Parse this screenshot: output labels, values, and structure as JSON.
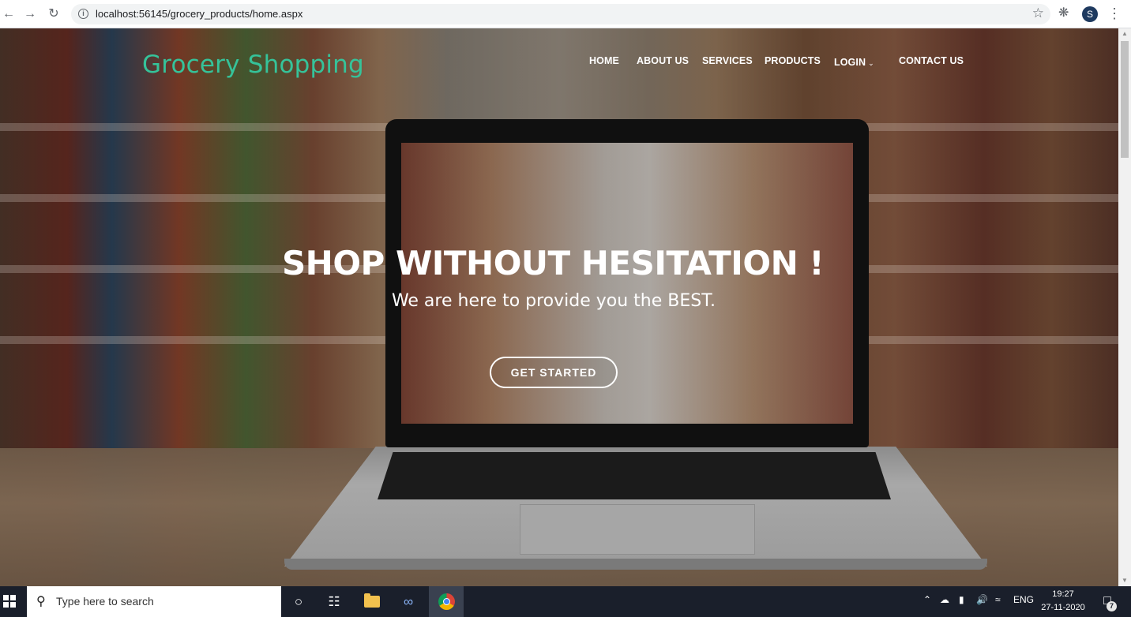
{
  "browser": {
    "url": "localhost:56145/grocery_products/home.aspx",
    "avatar_letter": "S"
  },
  "site": {
    "brand": "Grocery Shopping",
    "brand_color": "#35c39a",
    "nav": [
      {
        "label": "HOME"
      },
      {
        "label": "ABOUT US"
      },
      {
        "label": "SERVICES"
      },
      {
        "label": "PRODUCTS"
      },
      {
        "label": "LOGIN",
        "has_dropdown": true
      },
      {
        "label": "CONTACT US"
      }
    ],
    "hero": {
      "title": "SHOP WITHOUT HESITATION !",
      "subtitle": "We are here to provide you the BEST.",
      "cta_label": "GET STARTED"
    }
  },
  "taskbar": {
    "search_placeholder": "Type here to search",
    "language": "ENG",
    "time": "19:27",
    "date": "27-11-2020",
    "notification_count": "7",
    "apps": [
      "task-view",
      "file-explorer",
      "infinity-app",
      "chrome"
    ]
  }
}
